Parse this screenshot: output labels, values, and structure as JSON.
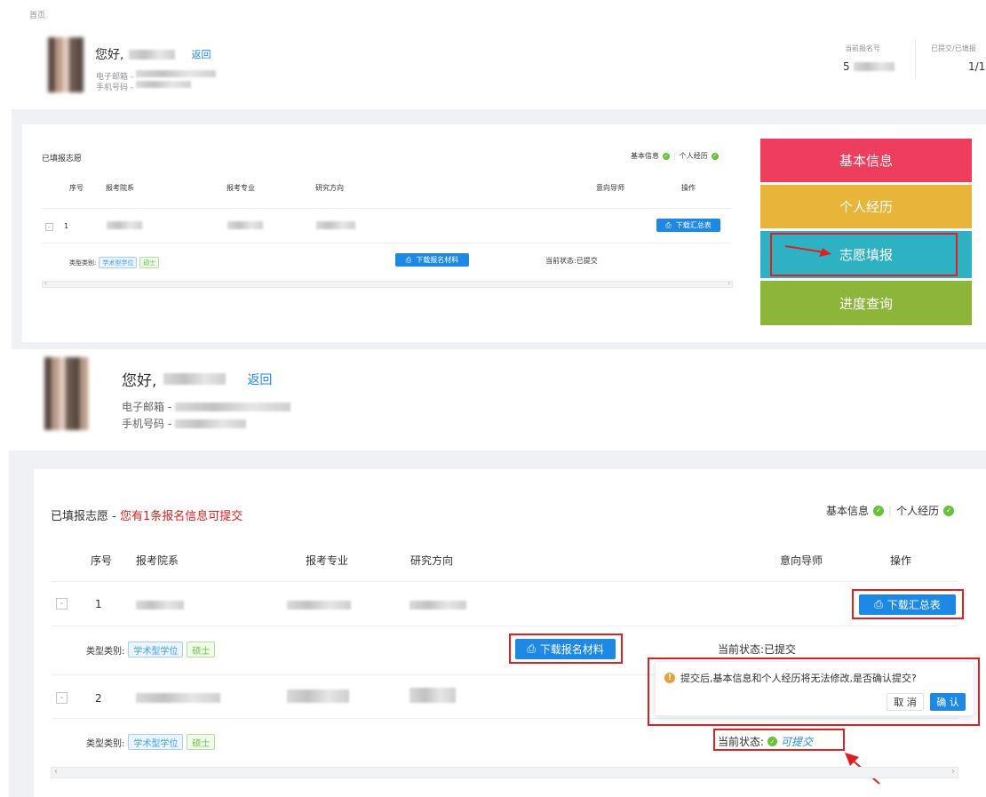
{
  "breadcrumb": "首页",
  "top": {
    "greeting": "您好,",
    "back": "返回",
    "email_label": "电子邮箱 -",
    "phone_label": "手机号码 -",
    "stat1_label": "当前报名号",
    "stat1_value_prefix": "5",
    "stat2_label": "已提交/已填报",
    "stat2_value": "1/1"
  },
  "small": {
    "title": "已填报志愿",
    "status_basic": "基本信息",
    "status_exp": "个人经历",
    "headers": {
      "no": "序号",
      "dept": "报考院系",
      "major": "报考专业",
      "dir": "研究方向",
      "tutor": "意向导师",
      "op": "操作"
    },
    "row_no": "1",
    "expand": "-",
    "download_summary": "下载汇总表",
    "type_label": "类型类别:",
    "tag1": "学术型学位",
    "tag2": "硕士",
    "download_materials": "下载报名材料",
    "status": "当前状态:已提交"
  },
  "nav": [
    {
      "label": "基本信息",
      "color": "#ee3e5d"
    },
    {
      "label": "个人经历",
      "color": "#e9b43a"
    },
    {
      "label": "志愿填报",
      "color": "#2eb1c3"
    },
    {
      "label": "进度查询",
      "color": "#8cb53a"
    }
  ],
  "big": {
    "greeting": "您好,",
    "back": "返回",
    "email_label": "电子邮箱 -",
    "phone_label": "手机号码 -",
    "title": "已填报志愿",
    "title_sep": " - ",
    "title_warning": "您有1条报名信息可提交",
    "status_basic": "基本信息",
    "status_exp": "个人经历",
    "headers": {
      "no": "序号",
      "dept": "报考院系",
      "major": "报考专业",
      "dir": "研究方向",
      "tutor": "意向导师",
      "op": "操作"
    },
    "row1_no": "1",
    "row2_no": "2",
    "expand": "-",
    "download_summary": "下载汇总表",
    "type_label": "类型类别:",
    "tag1": "学术型学位",
    "tag2": "硕士",
    "download_materials": "下载报名材料",
    "status1": "当前状态:已提交",
    "status2_label": "当前状态:",
    "status2_value": "可提交",
    "confirm_text": "提交后,基本信息和个人经历将无法修改,是否确认提交?",
    "cancel": "取 消",
    "ok": "确 认"
  },
  "colors": {
    "primary": "#1e88e5",
    "danger": "#e02020",
    "success": "#67c23a"
  }
}
